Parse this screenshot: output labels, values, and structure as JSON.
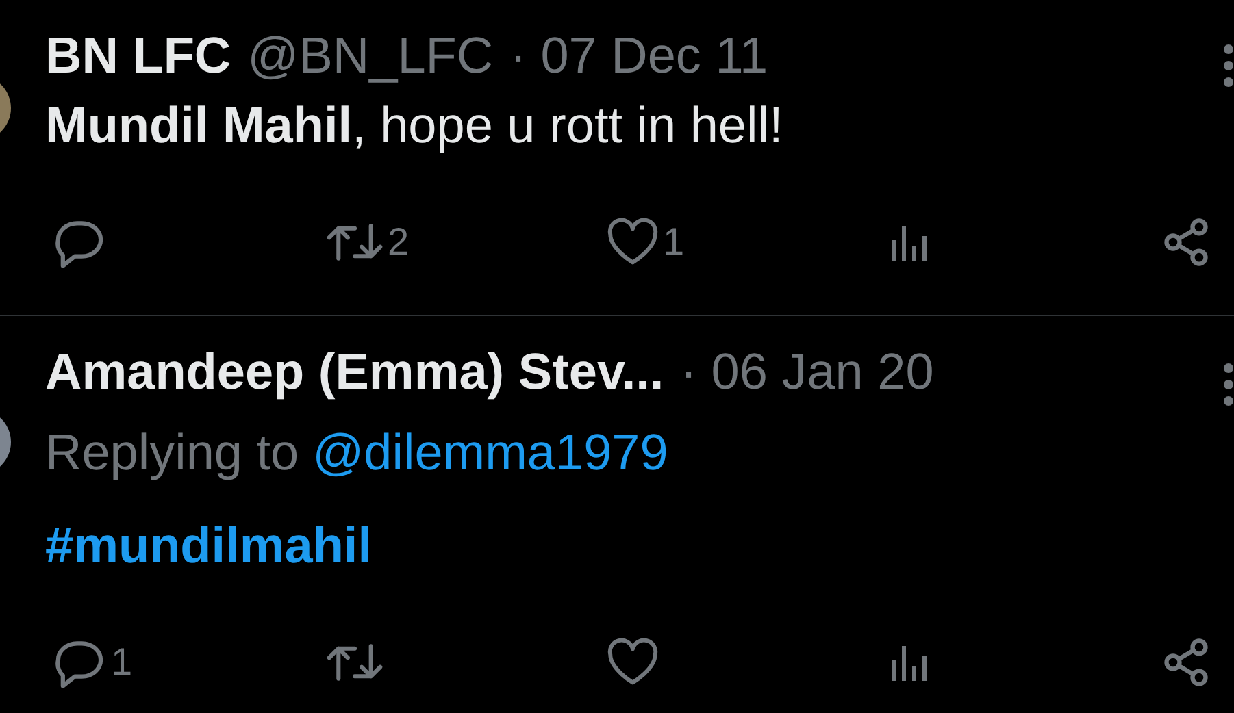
{
  "tweets": [
    {
      "name": "BN LFC",
      "handle": "@BN_LFC",
      "time": "· 07 Dec 11",
      "body": {
        "kind": "text",
        "text": "**Mundil Mahil**, hope u rott in hell!"
      },
      "actions": [
        {
          "kind": "reply"
        },
        {
          "kind": "retweet",
          "count": "2"
        },
        {
          "kind": "like",
          "count": "1"
        },
        {
          "kind": "views"
        },
        {
          "kind": "share"
        }
      ]
    },
    {
      "name": "Amandeep (Emma) Stev...",
      "time": "· 06 Jan 20",
      "replying": {
        "prefix": "Replying to",
        "handle": "@dilemma1979"
      },
      "body": {
        "kind": "hashtag",
        "text": "#mundilmahil"
      },
      "actions": [
        {
          "kind": "reply",
          "count": "1"
        },
        {
          "kind": "retweet"
        },
        {
          "kind": "like"
        },
        {
          "kind": "views"
        },
        {
          "kind": "share"
        }
      ]
    }
  ]
}
